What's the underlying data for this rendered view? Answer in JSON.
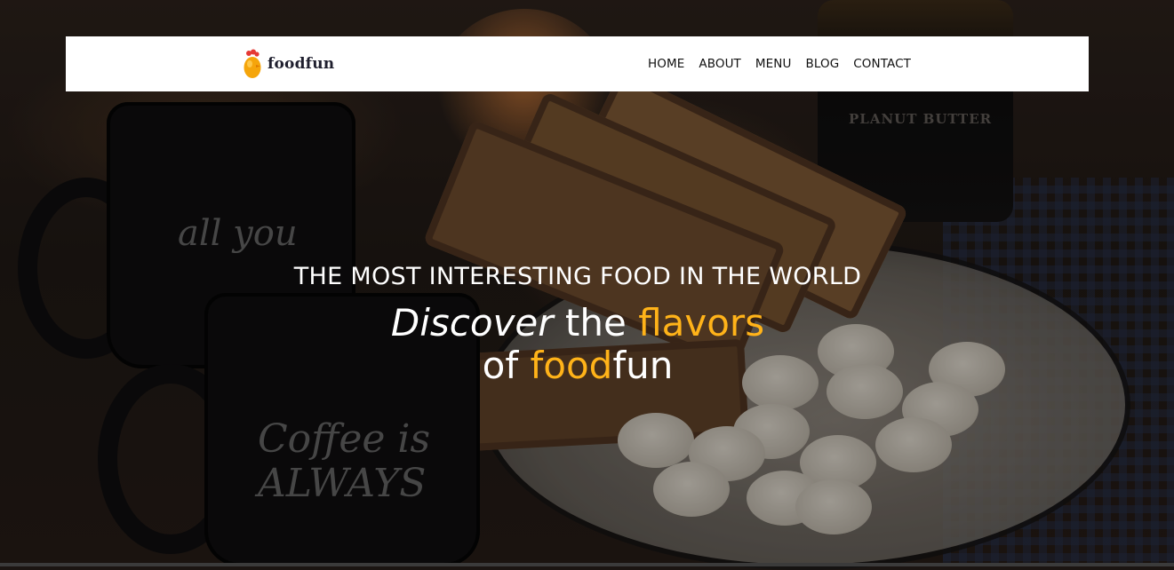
{
  "brand": {
    "name": "foodfun",
    "logo_icon": "egg-chick-icon",
    "accent_color": "#ffb319"
  },
  "nav": {
    "items": [
      {
        "label": "HOME"
      },
      {
        "label": "ABOUT"
      },
      {
        "label": "MENU"
      },
      {
        "label": "BLOG"
      },
      {
        "label": "CONTACT"
      }
    ]
  },
  "hero": {
    "eyebrow": "THE MOST INTERESTING FOOD IN THE WORLD",
    "line1": {
      "word1": "Discover",
      "word2": " the ",
      "word3": "flavors"
    },
    "line2": {
      "word1": "of ",
      "word2": "food",
      "word3": "fun"
    },
    "text_color": "#ffffff",
    "background_description_icon": "breakfast-photo"
  },
  "photo_props": {
    "mug_top_text": "all you",
    "mug_bottom_text": "Coffee is ALWAYS",
    "jar_text": "PLANUT BUTTER"
  }
}
